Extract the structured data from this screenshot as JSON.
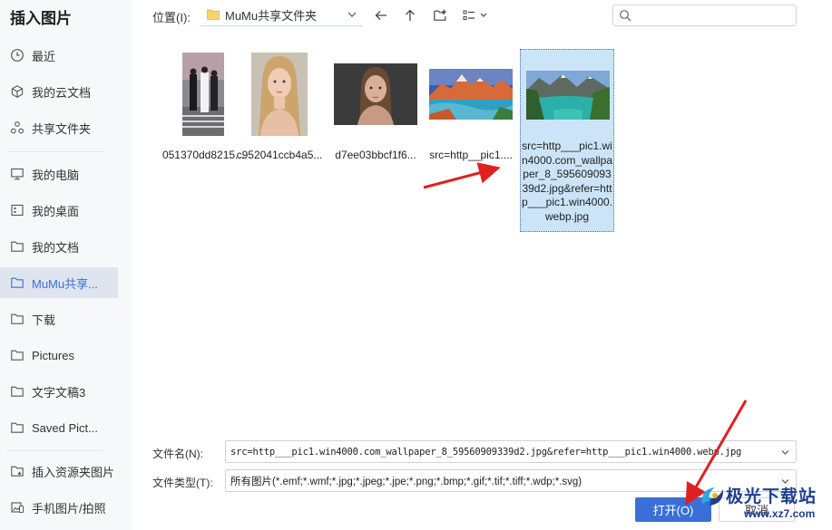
{
  "dialog": {
    "title": "插入图片"
  },
  "sidebar": {
    "items": [
      {
        "label": "最近",
        "icon": "clock-icon"
      },
      {
        "label": "我的云文档",
        "icon": "cube-icon"
      },
      {
        "label": "共享文件夹",
        "icon": "share-icon"
      },
      {
        "label": "我的电脑",
        "icon": "monitor-icon"
      },
      {
        "label": "我的桌面",
        "icon": "desktop-icon"
      },
      {
        "label": "我的文档",
        "icon": "folder-icon"
      },
      {
        "label": "MuMu共享...",
        "icon": "folder-icon",
        "active": true
      },
      {
        "label": "下载",
        "icon": "folder-icon"
      },
      {
        "label": "Pictures",
        "icon": "folder-icon"
      },
      {
        "label": "文字文稿3",
        "icon": "folder-icon"
      },
      {
        "label": "Saved Pict...",
        "icon": "folder-icon"
      },
      {
        "label": "插入资源夹图片",
        "icon": "star-folder-icon"
      },
      {
        "label": "手机图片/拍照",
        "icon": "phone-icon"
      }
    ]
  },
  "toolbar": {
    "location_label": "位置(I):",
    "location_value": "MuMu共享文件夹",
    "search_placeholder": ""
  },
  "files": [
    {
      "name": "051370dd8215...",
      "thumb": "street-photo"
    },
    {
      "name": "c952041ccb4a5...",
      "thumb": "portrait-blonde"
    },
    {
      "name": "d7ee03bbcf1f6...",
      "thumb": "portrait-dark"
    },
    {
      "name": "src=http__pic1....",
      "thumb": "mountain-lake"
    },
    {
      "name": "src=http___pic1.win4000.com_wallpaper_8_59560909339d2.jpg&refer=http___pic1.win4000.webp.jpg",
      "thumb": "lake-landscape",
      "selected": true
    }
  ],
  "fields": {
    "filename_label": "文件名(N):",
    "filename_value": "src=http___pic1.win4000.com_wallpaper_8_59560909339d2.jpg&refer=http___pic1.win4000.webp.jpg",
    "filetype_label": "文件类型(T):",
    "filetype_value": "所有图片(*.emf;*.wmf;*.jpg;*.jpeg;*.jpe;*.png;*.bmp;*.gif;*.tif;*.tiff;*.wdp;*.svg)"
  },
  "buttons": {
    "open": "打开(O)",
    "cancel": "取消"
  },
  "watermark": {
    "title": "极光下载站",
    "url": "www.xz7.com"
  },
  "colors": {
    "accent": "#3a6fd8",
    "selection": "#cce4f7",
    "arrow": "#e02020"
  }
}
